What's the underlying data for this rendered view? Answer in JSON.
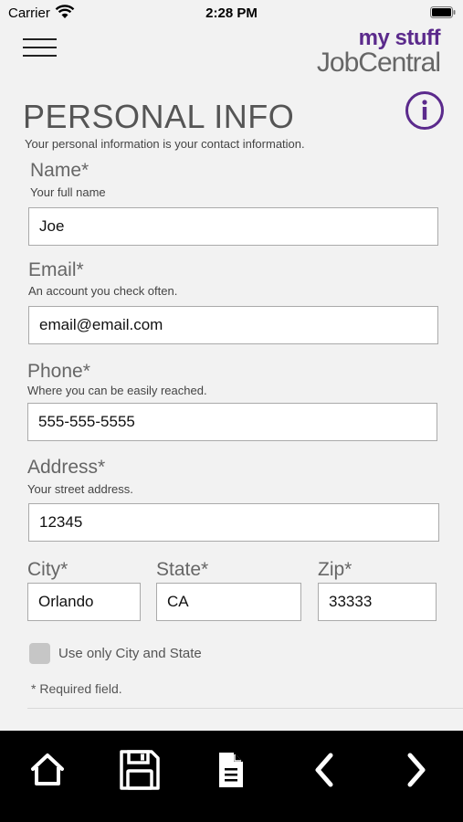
{
  "status_bar": {
    "carrier": "Carrier",
    "time": "2:28 PM",
    "icons": [
      "wifi-icon",
      "battery-icon"
    ]
  },
  "header": {
    "logo_top": "my stuff",
    "logo_bottom": "JobCentral",
    "icons": [
      "menu-icon",
      "info-icon"
    ]
  },
  "page": {
    "title": "PERSONAL INFO",
    "subtitle": "Your personal information is your contact information."
  },
  "form": {
    "name": {
      "label": "Name*",
      "hint": "Your full name",
      "value": "Joe"
    },
    "email": {
      "label": "Email*",
      "hint": "An account you check often.",
      "value": "email@email.com"
    },
    "phone": {
      "label": "Phone*",
      "hint": "Where you can be easily reached.",
      "value": "555-555-5555"
    },
    "address": {
      "label": "Address*",
      "hint": "Your street address.",
      "value": "12345"
    },
    "city": {
      "label": "City*",
      "value": "Orlando"
    },
    "state": {
      "label": "State*",
      "value": "CA"
    },
    "zip": {
      "label": "Zip*",
      "value": "33333"
    },
    "use_city_state": {
      "label": "Use only City and State",
      "checked": false
    },
    "required_note": "* Required field."
  },
  "bottom_bar": {
    "icons": [
      "home-icon",
      "save-icon",
      "document-icon",
      "back-arrow-icon",
      "forward-arrow-icon"
    ]
  },
  "colors": {
    "brand_purple": "#5b2a8c",
    "background": "#f2f2f2",
    "bottom_bar": "#000000"
  }
}
